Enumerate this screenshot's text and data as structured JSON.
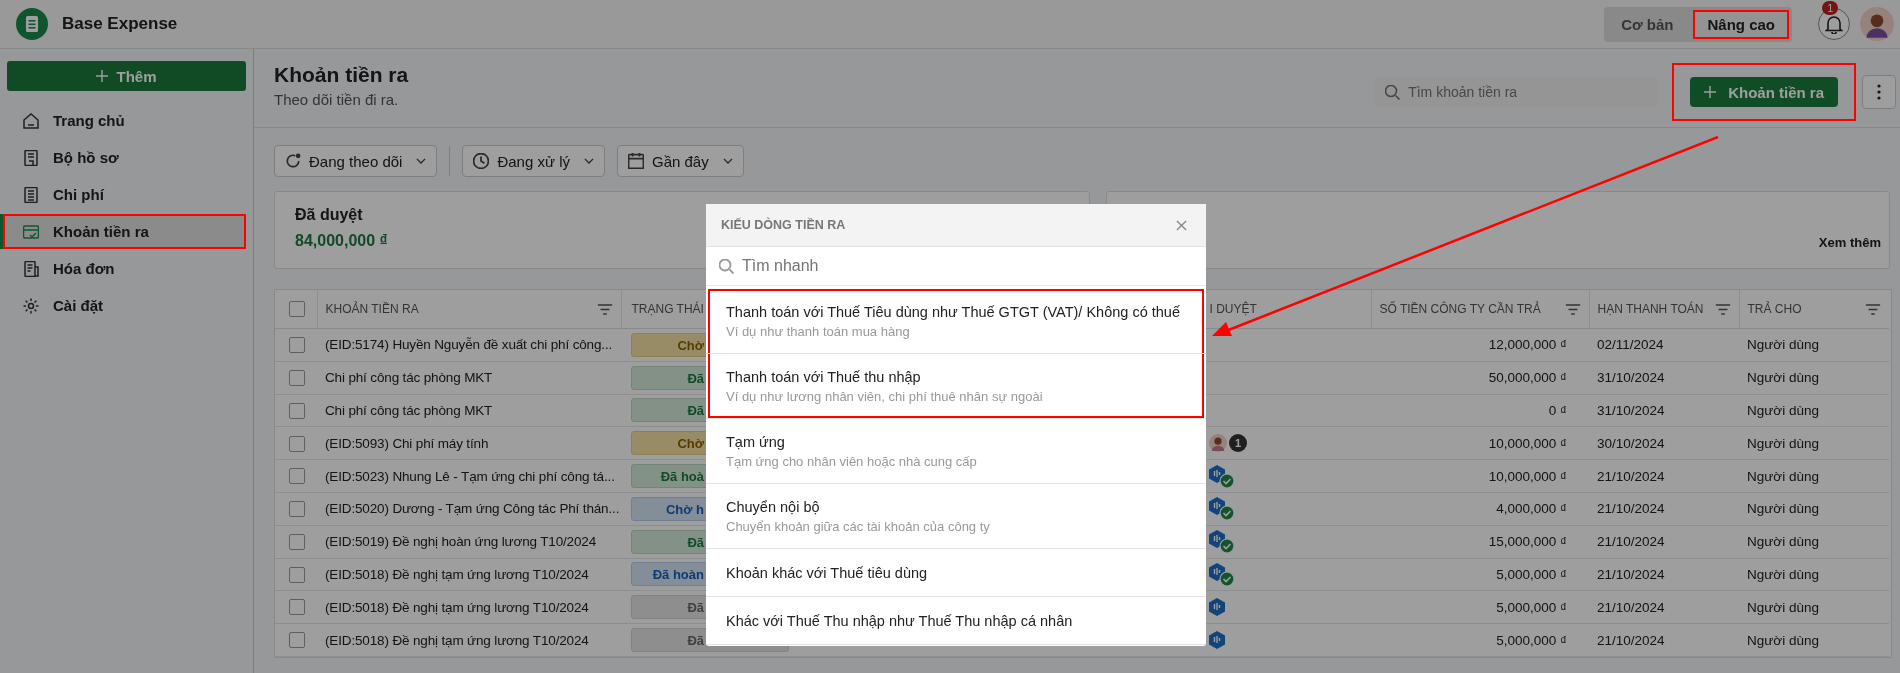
{
  "app": {
    "name": "Base Expense"
  },
  "mode_toggle": [
    {
      "label": "Cơ bản",
      "selected": false,
      "annotated": false
    },
    {
      "label": "Nâng cao",
      "selected": true,
      "annotated": true
    }
  ],
  "notifications": {
    "count": "1"
  },
  "sidebar": {
    "add_button": "Thêm",
    "items": [
      {
        "label": "Trang chủ",
        "selected": false,
        "annotated": false
      },
      {
        "label": "Bộ hồ sơ",
        "selected": false,
        "annotated": false
      },
      {
        "label": "Chi phí",
        "selected": false,
        "annotated": false
      },
      {
        "label": "Khoản tiền ra",
        "selected": true,
        "annotated": true
      },
      {
        "label": "Hóa đơn",
        "selected": false,
        "annotated": false
      },
      {
        "label": "Cài đặt",
        "selected": false,
        "annotated": false
      }
    ]
  },
  "page": {
    "title": "Khoản tiền ra",
    "subtitle": "Theo dõi tiền đi ra.",
    "search": {
      "placeholder": "Tìm khoản tiền ra"
    },
    "add_button": {
      "label": "Khoản tiền ra",
      "annotated": true
    }
  },
  "filters": [
    "Đang theo dõi",
    "Đang xử lý",
    "Gần đây"
  ],
  "summary": {
    "title": "Đã duyệt",
    "amount": "84,000,000 ₫",
    "link": "Xem thêm"
  },
  "table": {
    "select_all": {
      "checked": false
    },
    "columns": [
      "KHOẢN TIỀN RA",
      "TRẠNG THÁI",
      "",
      "I DUYỆT",
      "SỐ TIỀN CÔNG TY CẦN TRẢ",
      "HẠN THANH TOÁN",
      "TRẢ CHO"
    ],
    "rows": [
      {
        "checked": false,
        "name": "(EID:5174) Huyền Nguyễn đề xuất chi phí công...",
        "status": {
          "label": "Chờ",
          "kind": "pending"
        },
        "amount": "12,000,000 ₫",
        "due": "02/11/2024",
        "pay_to": "Người dùng"
      },
      {
        "checked": false,
        "name": "Chi phí công tác phòng MKT",
        "status": {
          "label": "Đã",
          "kind": "approved"
        },
        "amount": "50,000,000 ₫",
        "due": "31/10/2024",
        "pay_to": "Người dùng"
      },
      {
        "checked": false,
        "name": "Chi phí công tác phòng MKT",
        "status": {
          "label": "Đã",
          "kind": "approved"
        },
        "amount": "0 ₫",
        "due": "31/10/2024",
        "pay_to": "Người dùng"
      },
      {
        "checked": false,
        "name": "(EID:5093) Chi phí máy tính",
        "status": {
          "label": "Chờ",
          "kind": "pending"
        },
        "approver": {
          "kind": "avatar",
          "count": "1"
        },
        "amount": "10,000,000 ₫",
        "due": "30/10/2024",
        "pay_to": "Người dùng"
      },
      {
        "checked": false,
        "name": "(EID:5023) Nhung Lê - Tạm ứng chi phí công tá...",
        "status": {
          "label": "Đã hoà",
          "kind": "approved"
        },
        "approver": {
          "kind": "bot",
          "approved": true
        },
        "amount": "10,000,000 ₫",
        "due": "21/10/2024",
        "pay_to": "Người dùng"
      },
      {
        "checked": false,
        "name": "(EID:5020) Dương - Tạm ứng Công tác Phí thán...",
        "status": {
          "label": "Chờ h",
          "kind": "processing"
        },
        "approver": {
          "kind": "bot",
          "approved": true
        },
        "amount": "4,000,000 ₫",
        "due": "21/10/2024",
        "pay_to": "Người dùng"
      },
      {
        "checked": false,
        "name": "(EID:5019) Đề nghị hoàn ứng lương T10/2024",
        "status": {
          "label": "Đã",
          "kind": "approved"
        },
        "approver": {
          "kind": "bot",
          "approved": true
        },
        "amount": "15,000,000 ₫",
        "due": "21/10/2024",
        "pay_to": "Người dùng"
      },
      {
        "checked": false,
        "name": "(EID:5018) Đề nghị tạm ứng lương T10/2024",
        "status": {
          "label": "Đã hoàn",
          "kind": "processing"
        },
        "approver": {
          "kind": "bot",
          "approved": true
        },
        "amount": "5,000,000 ₫",
        "due": "21/10/2024",
        "pay_to": "Người dùng"
      },
      {
        "checked": false,
        "name": "(EID:5018) Đề nghị tạm ứng lương T10/2024",
        "status": {
          "label": "Đã",
          "kind": "cancelled"
        },
        "approver": {
          "kind": "bot",
          "approved": false
        },
        "amount": "5,000,000 ₫",
        "due": "21/10/2024",
        "pay_to": "Người dùng"
      },
      {
        "checked": false,
        "name": "(EID:5018) Đề nghị tạm ứng lương T10/2024",
        "status": {
          "label": "Đã",
          "kind": "cancelled"
        },
        "approver": {
          "kind": "bot",
          "approved": false
        },
        "amount": "5,000,000 ₫",
        "due": "21/10/2024",
        "pay_to": "Người dùng"
      }
    ]
  },
  "modal": {
    "title": "KIẾU DÒNG TIỀN RA",
    "search": {
      "placeholder": "Tìm nhanh"
    },
    "options": [
      {
        "title": "Thanh toán với Thuế Tiêu dùng như Thuế GTGT (VAT)/ Không có thuế",
        "description": "Ví dụ như thanh toán mua hàng",
        "annotated": true
      },
      {
        "title": "Thanh toán với Thuế thu nhập",
        "description": "Ví dụ như lương nhân viên, chi phí thuê nhân sự ngoài",
        "annotated": true
      },
      {
        "title": "Tạm ứng",
        "description": "Tạm ứng cho nhân viên hoặc nhà cung cấp",
        "annotated": false
      },
      {
        "title": "Chuyển nội bộ",
        "description": "Chuyển khoản giữa các tài khoản của công ty",
        "annotated": false
      },
      {
        "title": "Khoản khác với Thuế tiêu dùng",
        "annotated": false
      },
      {
        "title": "Khác với Thuế Thu nhập như Thuế Thu nhập cá nhân",
        "annotated": false
      }
    ]
  }
}
